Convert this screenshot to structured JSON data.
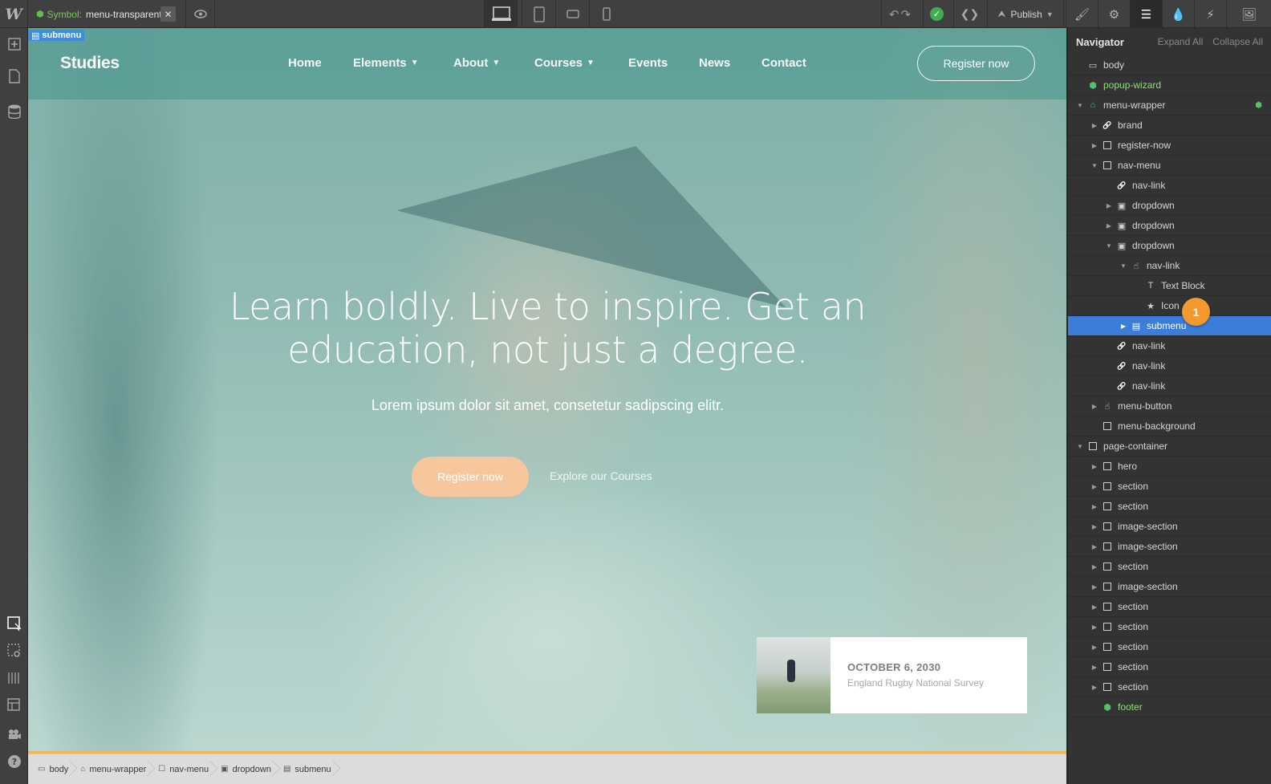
{
  "app": {
    "logo": "W",
    "symbol_label": "Symbol:",
    "symbol_name": "menu-transparent",
    "publish_label": "Publish"
  },
  "canvas": {
    "selection_tag": "submenu",
    "site": {
      "brand": "Studies",
      "nav": [
        {
          "label": "Home",
          "dropdown": false
        },
        {
          "label": "Elements",
          "dropdown": true
        },
        {
          "label": "About",
          "dropdown": true
        },
        {
          "label": "Courses",
          "dropdown": true
        },
        {
          "label": "Events",
          "dropdown": false
        },
        {
          "label": "News",
          "dropdown": false
        },
        {
          "label": "Contact",
          "dropdown": false
        }
      ],
      "register_label": "Register now",
      "hero_title": "Learn boldly. Live to inspire. Get an education, not just a degree.",
      "hero_subtitle": "Lorem ipsum dolor sit amet, consetetur sadipscing elitr.",
      "hero_register_label": "Register now",
      "hero_explore_label": "Explore our Courses",
      "event": {
        "date": "OCTOBER 6, 2030",
        "title": "England Rugby National Survey"
      }
    }
  },
  "breadcrumb": [
    {
      "label": "body",
      "icon": "page-icon"
    },
    {
      "label": "menu-wrapper",
      "icon": "home-icon"
    },
    {
      "label": "nav-menu",
      "icon": "box-icon"
    },
    {
      "label": "dropdown",
      "icon": "dropdown-icon"
    },
    {
      "label": "submenu",
      "icon": "list-icon"
    }
  ],
  "navigator": {
    "title": "Navigator",
    "expand_all": "Expand All",
    "collapse_all": "Collapse All",
    "badge": "1",
    "items": [
      {
        "label": "body",
        "depth": 0,
        "arrow": "",
        "icon": "page"
      },
      {
        "label": "popup-wizard",
        "depth": 0,
        "arrow": "",
        "icon": "symbol",
        "green": true
      },
      {
        "label": "menu-wrapper",
        "depth": 0,
        "arrow": "down",
        "icon": "home",
        "green": true,
        "symbol_mark": true
      },
      {
        "label": "brand",
        "depth": 1,
        "arrow": "right",
        "icon": "link"
      },
      {
        "label": "register-now",
        "depth": 1,
        "arrow": "right",
        "icon": "box"
      },
      {
        "label": "nav-menu",
        "depth": 1,
        "arrow": "down",
        "icon": "box"
      },
      {
        "label": "nav-link",
        "depth": 2,
        "arrow": "",
        "icon": "link"
      },
      {
        "label": "dropdown",
        "depth": 2,
        "arrow": "right",
        "icon": "dropdown"
      },
      {
        "label": "dropdown",
        "depth": 2,
        "arrow": "right",
        "icon": "dropdown"
      },
      {
        "label": "dropdown",
        "depth": 2,
        "arrow": "down",
        "icon": "dropdown"
      },
      {
        "label": "nav-link",
        "depth": 3,
        "arrow": "down",
        "icon": "hand"
      },
      {
        "label": "Text Block",
        "depth": 4,
        "arrow": "",
        "icon": "text"
      },
      {
        "label": "Icon",
        "depth": 4,
        "arrow": "",
        "icon": "star"
      },
      {
        "label": "submenu",
        "depth": 3,
        "arrow": "right",
        "icon": "list",
        "selected": true
      },
      {
        "label": "nav-link",
        "depth": 2,
        "arrow": "",
        "icon": "link"
      },
      {
        "label": "nav-link",
        "depth": 2,
        "arrow": "",
        "icon": "link"
      },
      {
        "label": "nav-link",
        "depth": 2,
        "arrow": "",
        "icon": "link"
      },
      {
        "label": "menu-button",
        "depth": 1,
        "arrow": "right",
        "icon": "hand"
      },
      {
        "label": "menu-background",
        "depth": 1,
        "arrow": "",
        "icon": "box"
      },
      {
        "label": "page-container",
        "depth": 0,
        "arrow": "down",
        "icon": "box"
      },
      {
        "label": "hero",
        "depth": 1,
        "arrow": "right",
        "icon": "box"
      },
      {
        "label": "section",
        "depth": 1,
        "arrow": "right",
        "icon": "box"
      },
      {
        "label": "section",
        "depth": 1,
        "arrow": "right",
        "icon": "box"
      },
      {
        "label": "image-section",
        "depth": 1,
        "arrow": "right",
        "icon": "box"
      },
      {
        "label": "image-section",
        "depth": 1,
        "arrow": "right",
        "icon": "box"
      },
      {
        "label": "section",
        "depth": 1,
        "arrow": "right",
        "icon": "box"
      },
      {
        "label": "image-section",
        "depth": 1,
        "arrow": "right",
        "icon": "box"
      },
      {
        "label": "section",
        "depth": 1,
        "arrow": "right",
        "icon": "box"
      },
      {
        "label": "section",
        "depth": 1,
        "arrow": "right",
        "icon": "box"
      },
      {
        "label": "section",
        "depth": 1,
        "arrow": "right",
        "icon": "box"
      },
      {
        "label": "section",
        "depth": 1,
        "arrow": "right",
        "icon": "box"
      },
      {
        "label": "section",
        "depth": 1,
        "arrow": "right",
        "icon": "box"
      },
      {
        "label": "footer",
        "depth": 1,
        "arrow": "",
        "icon": "symbol",
        "green": true
      }
    ]
  },
  "colors": {
    "selection_blue": "#3b7dd8",
    "symbol_green": "#4fc36a",
    "badge_orange": "#f29a2e",
    "cta_peach": "#f6c79d"
  }
}
